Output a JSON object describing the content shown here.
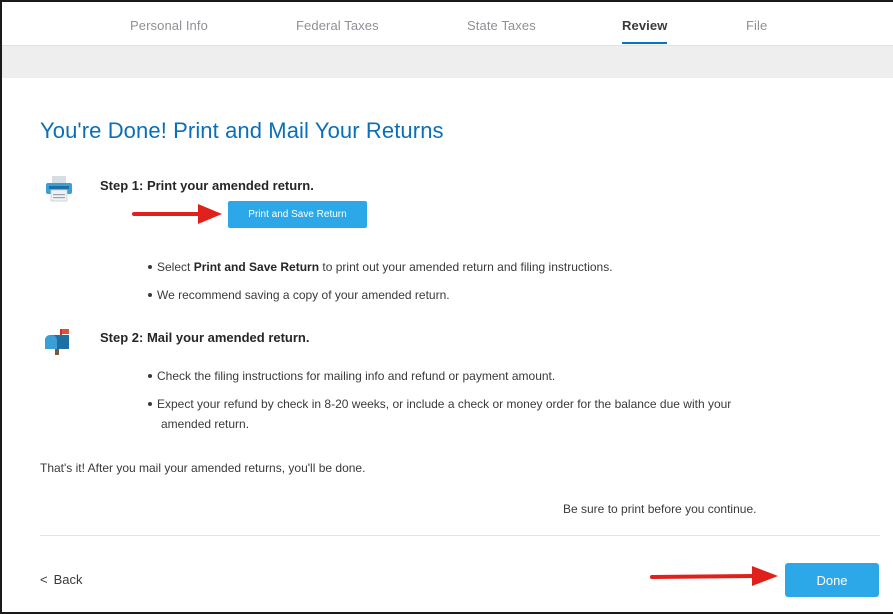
{
  "nav": {
    "tabs": [
      {
        "label": "Personal Info"
      },
      {
        "label": "Federal Taxes"
      },
      {
        "label": "State Taxes"
      },
      {
        "label": "Review"
      },
      {
        "label": "File"
      }
    ],
    "active_tab": "Review"
  },
  "page": {
    "title": "You're Done! Print and Mail Your Returns"
  },
  "step1": {
    "icon": "printer-icon",
    "title": "Step 1: Print your amended return.",
    "button_label": "Print and Save Return",
    "bullets": [
      {
        "pre": "Select ",
        "bold": "Print and Save Return",
        "post": " to print out your amended return and filing instructions."
      },
      {
        "pre": "We recommend saving a copy of your amended return.",
        "bold": "",
        "post": ""
      }
    ]
  },
  "step2": {
    "icon": "mailbox-icon",
    "title": "Step 2: Mail your amended return.",
    "bullets": [
      "Check the filing instructions for mailing info and refund or payment amount.",
      "Expect your refund by check in 8-20 weeks, or include a check or money order for the balance due with your",
      "amended return."
    ]
  },
  "closing_text": "That's it! After you mail your amended returns, you'll be done.",
  "print_reminder": "Be sure to print before you continue.",
  "footer": {
    "back_label": "Back",
    "done_label": "Done"
  },
  "colors": {
    "accent": "#2ca8e8",
    "title": "#0a6fb8",
    "active_underline": "#0077c5",
    "annotation_arrow": "#e0201b"
  }
}
